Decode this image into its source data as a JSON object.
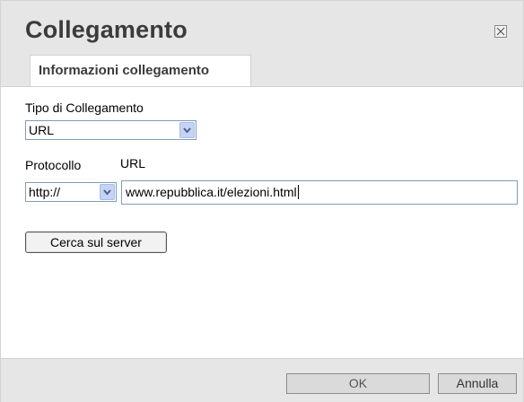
{
  "dialog": {
    "title": "Collegamento",
    "close_icon": "close-icon",
    "tab_label": "Informazioni collegamento"
  },
  "form": {
    "link_type_label": "Tipo di Collegamento",
    "link_type_value": "URL",
    "protocol_label": "Protocollo",
    "protocol_value": "http://",
    "url_label": "URL",
    "url_value": "www.repubblica.it/elezioni.html",
    "browse_button": "Cerca sul server"
  },
  "footer": {
    "ok_label": "OK",
    "cancel_label": "Annulla"
  },
  "colors": {
    "header_bg": "#e6e6e6",
    "input_border": "#7f9db9",
    "dropdown_arrow_bg": "#c4d3f6"
  }
}
